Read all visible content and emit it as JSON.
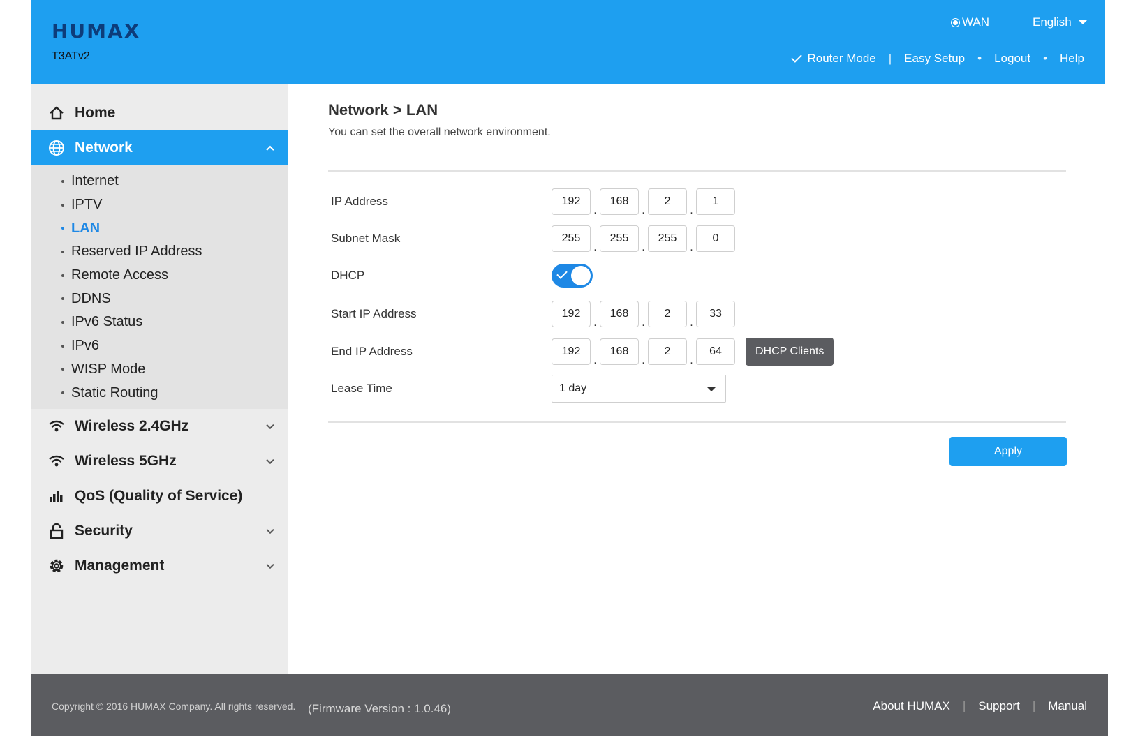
{
  "header": {
    "brand": "HUMAX",
    "model": "T3ATv2",
    "wan_label": "WAN",
    "language": "English",
    "nav": {
      "router_mode": "Router Mode",
      "sep1": "|",
      "easy_setup": "Easy Setup",
      "sep2": "•",
      "logout": "Logout",
      "sep3": "•",
      "help": "Help"
    }
  },
  "sidebar": {
    "home": "Home",
    "network": "Network",
    "network_items": [
      "Internet",
      "IPTV",
      "LAN",
      "Reserved IP Address",
      "Remote Access",
      "DDNS",
      "IPv6 Status",
      "IPv6",
      "WISP Mode",
      "Static Routing"
    ],
    "active_item": "LAN",
    "wireless24": "Wireless 2.4GHz",
    "wireless5": "Wireless 5GHz",
    "qos": "QoS (Quality of Service)",
    "security": "Security",
    "management": "Management"
  },
  "main": {
    "title": "Network > LAN",
    "description": "You can set the overall network environment.",
    "ip_address": {
      "label": "IP Address",
      "octets": [
        "192",
        "168",
        "2",
        "1"
      ]
    },
    "subnet_mask": {
      "label": "Subnet Mask",
      "octets": [
        "255",
        "255",
        "255",
        "0"
      ]
    },
    "dhcp": {
      "label": "DHCP",
      "enabled": true
    },
    "start_ip": {
      "label": "Start IP Address",
      "octets": [
        "192",
        "168",
        "2",
        "33"
      ]
    },
    "end_ip": {
      "label": "End IP Address",
      "octets": [
        "192",
        "168",
        "2",
        "64"
      ]
    },
    "dhcp_clients_button": "DHCP Clients",
    "lease_time": {
      "label": "Lease Time",
      "value": "1 day"
    },
    "apply_button": "Apply",
    "dot": "."
  },
  "footer": {
    "copyright": "Copyright © 2016 HUMAX Company. All rights reserved.",
    "firmware": "(Firmware Version : 1.0.46)",
    "about": "About HUMAX",
    "support": "Support",
    "manual": "Manual",
    "sep": "|"
  },
  "colors": {
    "accent": "#1e9ff0",
    "active_text": "#1e88e5",
    "footer_bg": "#5b5c60",
    "sidebar_bg": "#ececec"
  }
}
